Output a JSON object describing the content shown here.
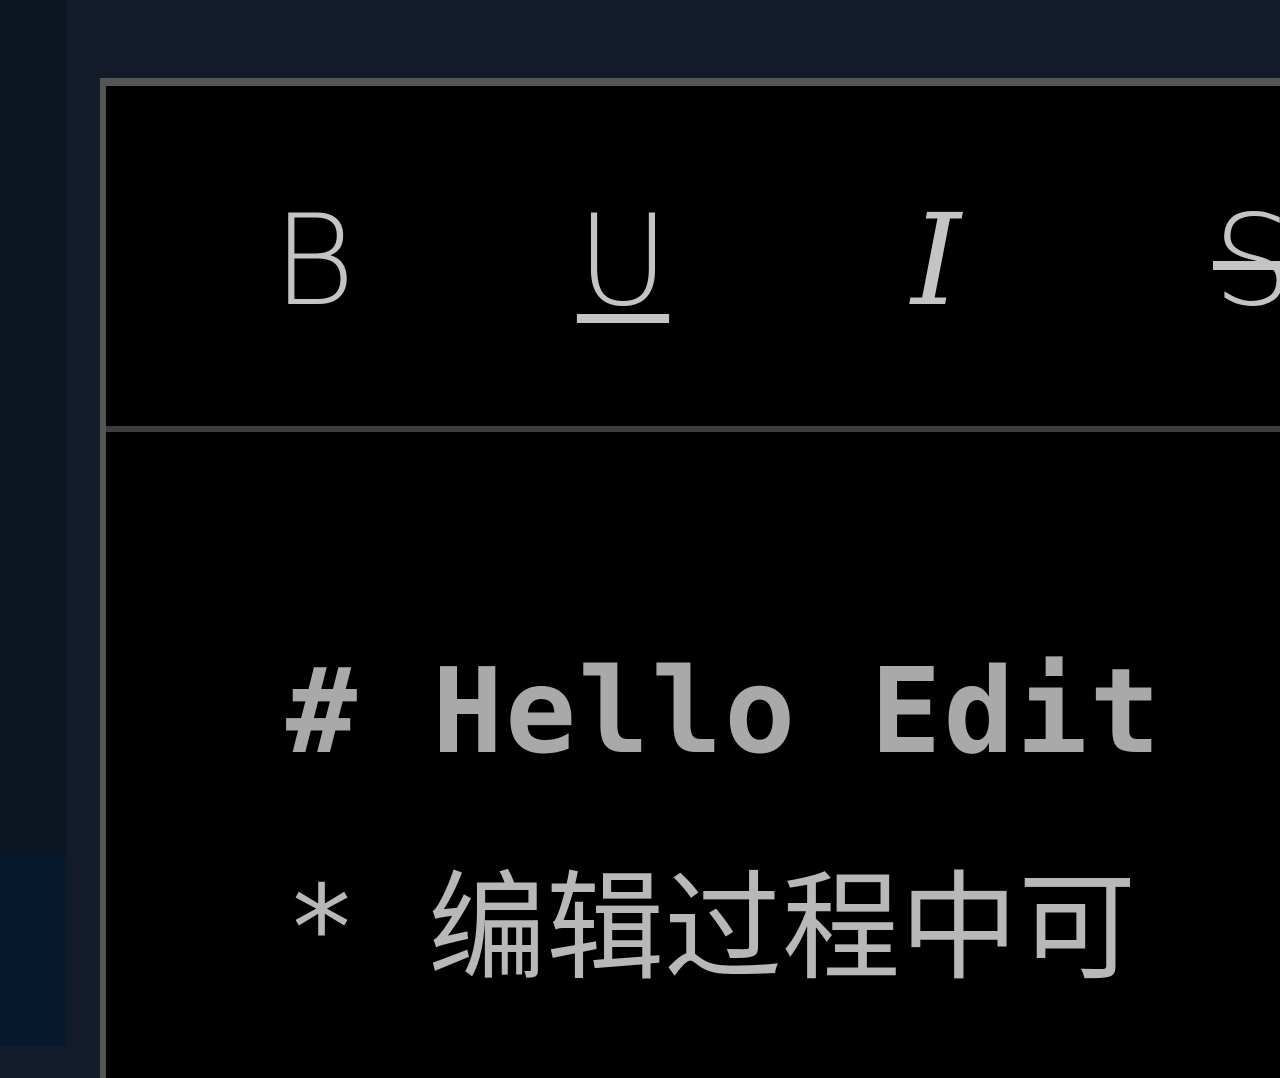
{
  "toolbar": {
    "bold_label": "B",
    "underline_label": "U",
    "italic_label": "I",
    "strike_label": "S"
  },
  "editor": {
    "line1": "# Hello Edit",
    "line2": "* 编辑过程中可"
  },
  "colors": {
    "page_background": "#131a2a",
    "editor_background": "#000000",
    "text": "#a9a9a9",
    "toolbar_icons": "#c4c4c4"
  }
}
